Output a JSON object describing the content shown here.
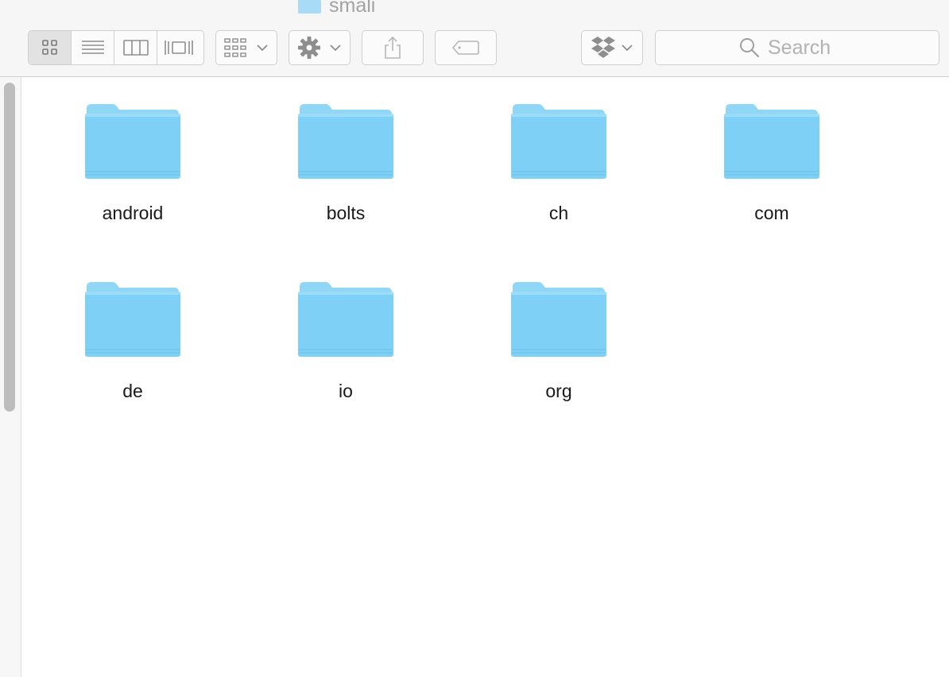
{
  "window": {
    "title": "smali"
  },
  "toolbar": {
    "view_modes": [
      {
        "id": "icon",
        "icon": "icon-view-icon",
        "active": true
      },
      {
        "id": "list",
        "icon": "list-view-icon",
        "active": false
      },
      {
        "id": "column",
        "icon": "column-view-icon",
        "active": false
      },
      {
        "id": "coverflow",
        "icon": "cover-flow-icon",
        "active": false
      }
    ],
    "arrange_icon": "arrange-grid-icon",
    "action_icon": "gear-icon",
    "share_icon": "share-icon",
    "tags_icon": "tag-icon",
    "dropbox_icon": "dropbox-icon"
  },
  "search": {
    "placeholder": "Search",
    "value": ""
  },
  "colors": {
    "folder_body": "#7fd0f6",
    "folder_tab": "#8fd6f7",
    "toolbar_bg": "#f6f6f6",
    "icon_gray": "#8e8e8e"
  },
  "folders": [
    {
      "name": "android"
    },
    {
      "name": "bolts"
    },
    {
      "name": "ch"
    },
    {
      "name": "com"
    },
    {
      "name": "de"
    },
    {
      "name": "io"
    },
    {
      "name": "org"
    }
  ]
}
